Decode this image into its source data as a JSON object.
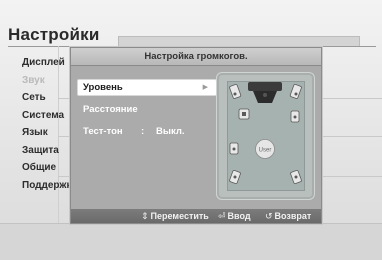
{
  "page": {
    "title": "Настройки"
  },
  "sidebar": {
    "items": [
      {
        "label": "Дисплей",
        "dimmed": false
      },
      {
        "label": "Звук",
        "dimmed": true
      },
      {
        "label": "Сеть",
        "dimmed": false
      },
      {
        "label": "Система",
        "dimmed": false
      },
      {
        "label": "Язык",
        "dimmed": false
      },
      {
        "label": "Защита",
        "dimmed": false
      },
      {
        "label": "Общие",
        "dimmed": false
      },
      {
        "label": "Поддержка",
        "dimmed": false
      }
    ]
  },
  "dialog": {
    "title": "Настройка громкогов.",
    "menu": [
      {
        "label": "Уровень",
        "selected": true,
        "has_arrow": true
      },
      {
        "label": "Расстояние",
        "selected": false
      },
      {
        "label": "Тест-тон",
        "separator": ":",
        "value": "Выкл.",
        "selected": false
      }
    ],
    "speaker_diagram": {
      "listener_label": "User"
    },
    "footer": {
      "move": {
        "icon": "⇕",
        "label": "Переместить"
      },
      "enter": {
        "icon": "⏎",
        "label": "Ввод"
      },
      "back": {
        "icon": "↺",
        "label": "Возврат"
      }
    }
  },
  "colors": {
    "dialog_bg": "#ababab",
    "highlight": "#ffffff",
    "footer_bg": "#707070"
  }
}
